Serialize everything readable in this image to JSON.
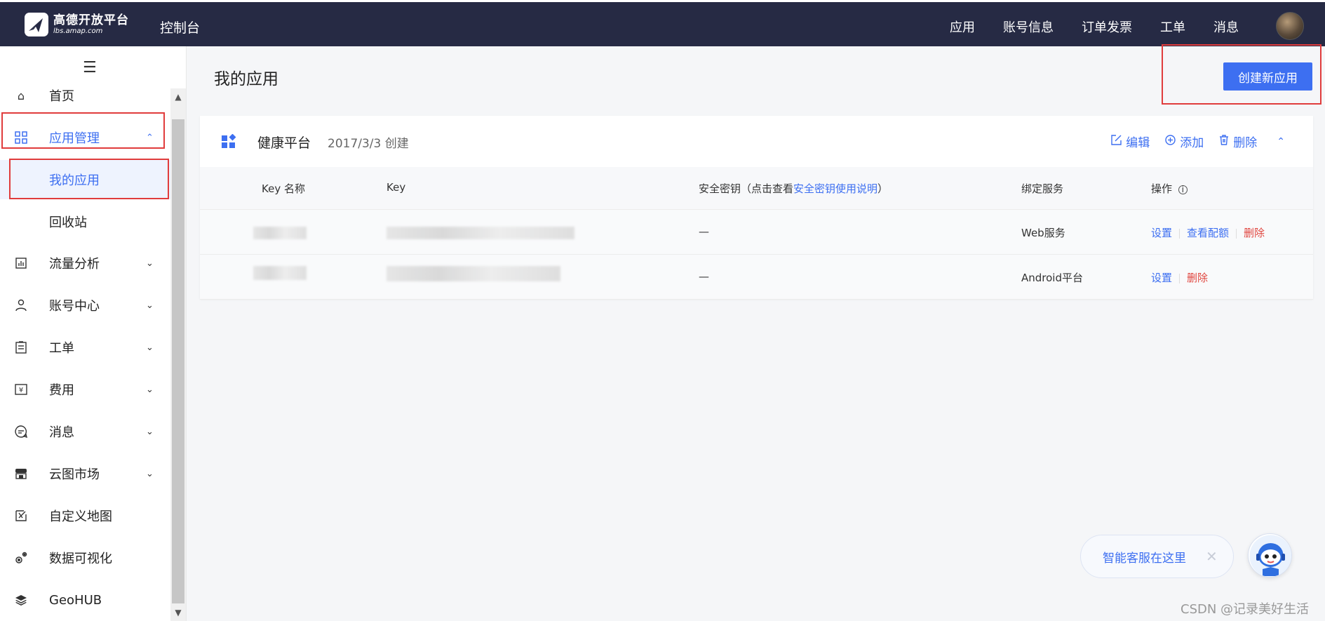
{
  "topbar": {
    "logo_cn": "高德开放平台",
    "logo_en": "lbs.amap.com",
    "console": "控制台",
    "nav": [
      "应用",
      "账号信息",
      "订单发票",
      "工单",
      "消息"
    ]
  },
  "sidebar": {
    "items": [
      {
        "label": "首页",
        "icon": "home-icon"
      },
      {
        "label": "应用管理",
        "icon": "grid-icon"
      },
      {
        "label": "我的应用"
      },
      {
        "label": "回收站"
      },
      {
        "label": "流量分析",
        "icon": "chart-icon"
      },
      {
        "label": "账号中心",
        "icon": "user-icon"
      },
      {
        "label": "工单",
        "icon": "ticket-icon"
      },
      {
        "label": "费用",
        "icon": "yen-icon"
      },
      {
        "label": "消息",
        "icon": "message-icon"
      },
      {
        "label": "云图市场",
        "icon": "store-icon"
      },
      {
        "label": "自定义地图",
        "icon": "map-edit-icon"
      },
      {
        "label": "数据可视化",
        "icon": "visual-icon"
      },
      {
        "label": "GeoHUB",
        "icon": "layers-icon"
      }
    ]
  },
  "main": {
    "title": "我的应用",
    "create_button": "创建新应用",
    "app": {
      "name": "健康平台",
      "date": "2017/3/3 创建",
      "actions": {
        "edit": "编辑",
        "add": "添加",
        "delete": "删除"
      }
    },
    "table": {
      "headers": {
        "key_name": "Key 名称",
        "key": "Key",
        "secret_prefix": "安全密钥（点击查看",
        "secret_link": "安全密钥使用说明",
        "secret_suffix": "）",
        "service": "绑定服务",
        "ops": "操作"
      },
      "rows": [
        {
          "secret": "—",
          "service": "Web服务",
          "ops": [
            "设置",
            "查看配额",
            "删除"
          ]
        },
        {
          "secret": "—",
          "service": "Android平台",
          "ops": [
            "设置",
            "删除"
          ]
        }
      ]
    }
  },
  "assistant": {
    "text": "智能客服在这里",
    "close": "✕"
  },
  "watermark": "CSDN @记录美好生活",
  "colors": {
    "accent": "#3d6ff1",
    "topbar": "#262a44",
    "danger": "#e0463f",
    "highlight": "#e03c3c"
  }
}
